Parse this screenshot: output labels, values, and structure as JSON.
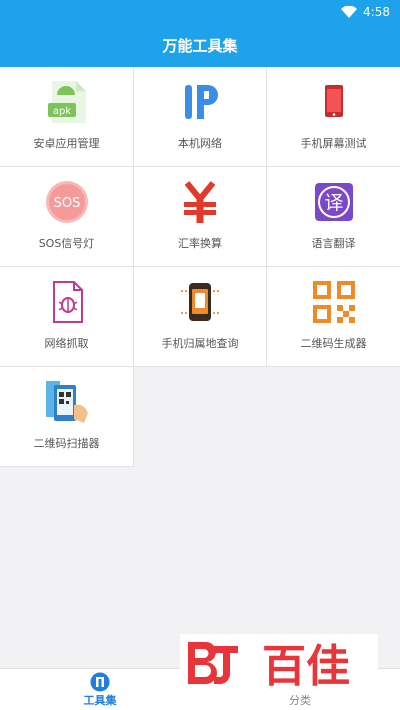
{
  "status_bar": {
    "time": "4:58",
    "wifi_icon": "wifi-icon",
    "battery_icon": "battery-icon"
  },
  "app_bar": {
    "title": "万能工具集"
  },
  "tools": [
    {
      "id": "app-manager",
      "label": "安卓应用管理",
      "icon": "apk-file-icon"
    },
    {
      "id": "local-network",
      "label": "本机网络",
      "icon": "ip-icon"
    },
    {
      "id": "screen-test",
      "label": "手机屏幕测试",
      "icon": "phone-screen-icon"
    },
    {
      "id": "sos-light",
      "label": "SOS信号灯",
      "icon": "sos-icon"
    },
    {
      "id": "currency-exchange",
      "label": "汇率换算",
      "icon": "yen-icon"
    },
    {
      "id": "translate",
      "label": "语言翻译",
      "icon": "translate-icon"
    },
    {
      "id": "packet-capture",
      "label": "网络抓取",
      "icon": "bug-file-icon"
    },
    {
      "id": "phone-location",
      "label": "手机归属地查询",
      "icon": "phone-location-icon"
    },
    {
      "id": "qr-generator",
      "label": "二维码生成器",
      "icon": "qr-code-icon"
    },
    {
      "id": "qr-scanner",
      "label": "二维码扫描器",
      "icon": "qr-scan-icon"
    }
  ],
  "bottom_nav": [
    {
      "label": "工具集",
      "icon": "toolbox-icon",
      "active": true
    },
    {
      "label": "分类",
      "icon": "category-icon",
      "active": false
    }
  ],
  "watermark": {
    "text": "百佳"
  },
  "colors": {
    "primary": "#1ea2e9",
    "nav_active": "#1e7fe0",
    "watermark_red": "#e8353a"
  }
}
